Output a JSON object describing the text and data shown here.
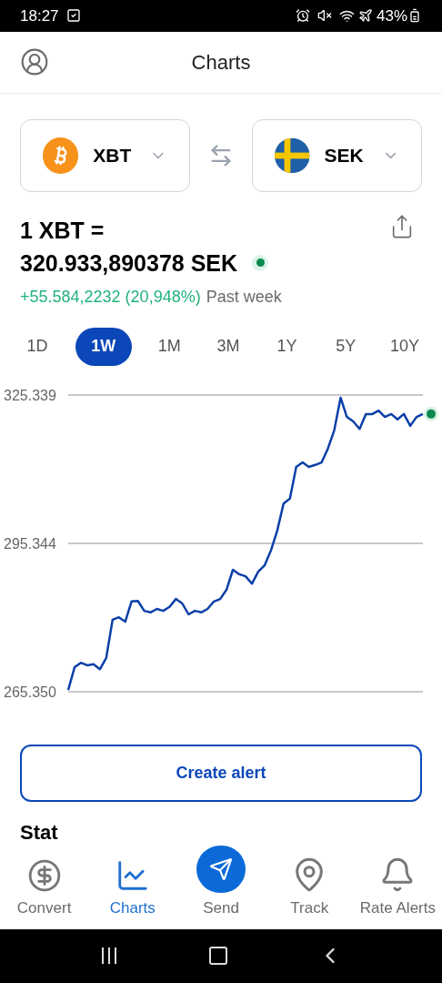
{
  "status_bar": {
    "time": "18:27",
    "battery": "43%"
  },
  "header": {
    "title": "Charts"
  },
  "pair": {
    "from": {
      "code": "XBT",
      "kind": "bitcoin"
    },
    "to": {
      "code": "SEK",
      "kind": "sweden"
    }
  },
  "rate": {
    "line1": "1 XBT =",
    "line2": "320.933,890378 SEK",
    "change": "+55.584,2232 (20,948%)",
    "period_label": "Past week"
  },
  "periods": [
    {
      "label": "1D",
      "selected": false
    },
    {
      "label": "1W",
      "selected": true
    },
    {
      "label": "1M",
      "selected": false
    },
    {
      "label": "3M",
      "selected": false
    },
    {
      "label": "1Y",
      "selected": false
    },
    {
      "label": "5Y",
      "selected": false
    },
    {
      "label": "10Y",
      "selected": false
    }
  ],
  "chart_data": {
    "type": "line",
    "ylim": [
      265350,
      325339
    ],
    "yticks": [
      {
        "value": 325339,
        "label": "325.339"
      },
      {
        "value": 295344,
        "label": "295.344"
      },
      {
        "value": 265350,
        "label": "265.350"
      }
    ],
    "values": [
      265700,
      270300,
      271200,
      270700,
      270900,
      269900,
      272200,
      279900,
      280400,
      279500,
      283600,
      283700,
      281700,
      281400,
      282100,
      281700,
      282500,
      284100,
      283200,
      281000,
      281700,
      281400,
      282100,
      283600,
      284100,
      286000,
      290000,
      289100,
      288700,
      287200,
      289600,
      290900,
      293900,
      297900,
      303400,
      304400,
      310800,
      311700,
      310800,
      311200,
      311700,
      314500,
      318200,
      324800,
      320900,
      320000,
      318500,
      321500,
      321500,
      322200,
      320900,
      321500,
      320400,
      321500,
      319100,
      320900,
      321500
    ]
  },
  "create_alert_button": "Create alert",
  "section_heading": "Stat",
  "bottom_nav": [
    {
      "label": "Convert",
      "kind": "convert",
      "selected": false
    },
    {
      "label": "Charts",
      "kind": "charts",
      "selected": true
    },
    {
      "label": "Send",
      "kind": "send",
      "selected": false
    },
    {
      "label": "Track",
      "kind": "track",
      "selected": false
    },
    {
      "label": "Rate Alerts",
      "kind": "alerts",
      "selected": false
    }
  ]
}
